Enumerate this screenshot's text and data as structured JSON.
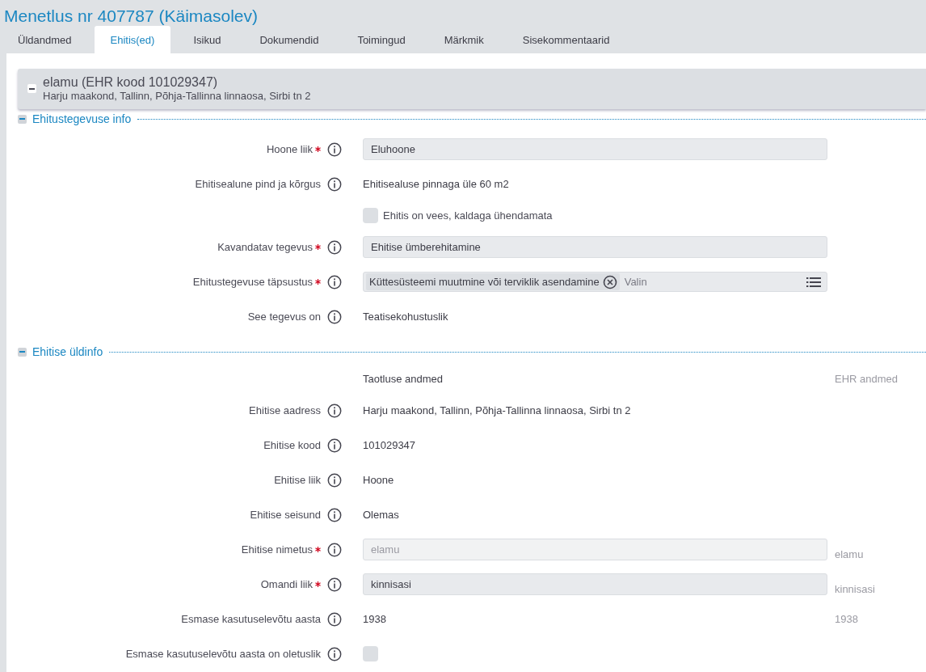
{
  "title": "Menetlus nr 407787 (Käimasolev)",
  "tabs": [
    {
      "label": "Üldandmed",
      "selected": false
    },
    {
      "label": "Ehitis(ed)",
      "selected": true
    },
    {
      "label": "Isikud",
      "selected": false
    },
    {
      "label": "Dokumendid",
      "selected": false
    },
    {
      "label": "Toimingud",
      "selected": false
    },
    {
      "label": "Märkmik",
      "selected": false
    },
    {
      "label": "Sisekommentaarid",
      "selected": false
    }
  ],
  "structure": {
    "title": "elamu (EHR kood 101029347)",
    "address": "Harju maakond, Tallinn, Põhja-Tallinna linnaosa, Sirbi tn 2",
    "expanded": true
  },
  "sections": [
    {
      "title": "Ehitustegevuse info",
      "expanded": true,
      "rows": [
        {
          "kind": "select",
          "label": "Hoone liik",
          "required": true,
          "value": "Eluhoone"
        },
        {
          "kind": "text",
          "label": "Ehitisealune pind ja kõrgus",
          "required": false,
          "value": "Ehitisealuse pinnaga üle 60 m2"
        },
        {
          "kind": "option",
          "text": "Ehitis on vees, kaldaga ühendamata",
          "checked": false
        },
        {
          "kind": "select",
          "label": "Kavandatav tegevus",
          "required": true,
          "value": "Ehitise ümberehitamine"
        },
        {
          "kind": "multiselect",
          "label": "Ehitustegevuse täpsustus",
          "required": true,
          "chips": [
            "Küttesüsteemi muutmine või terviklik asendamine"
          ],
          "placeholder": "Valin"
        },
        {
          "kind": "text",
          "label": "See tegevus on",
          "required": false,
          "value": "Teatisekohustuslik"
        }
      ]
    },
    {
      "title": "Ehitise üldinfo",
      "expanded": true,
      "headings": {
        "application": "Taotluse andmed",
        "ehr": "EHR andmed"
      },
      "rows": [
        {
          "kind": "text",
          "label": "Ehitise aadress",
          "required": false,
          "value": "Harju maakond, Tallinn, Põhja-Tallinna linnaosa, Sirbi tn 2"
        },
        {
          "kind": "text",
          "label": "Ehitise kood",
          "required": false,
          "value": "101029347"
        },
        {
          "kind": "text",
          "label": "Ehitise liik",
          "required": false,
          "value": "Hoone"
        },
        {
          "kind": "text",
          "label": "Ehitise seisund",
          "required": false,
          "value": "Olemas"
        },
        {
          "kind": "input",
          "label": "Ehitise nimetus",
          "required": true,
          "value": "elamu",
          "disabled": true,
          "ehr": "elamu"
        },
        {
          "kind": "input",
          "label": "Omandi liik",
          "required": true,
          "value": "kinnisasi",
          "disabled": false,
          "ehr": "kinnisasi"
        },
        {
          "kind": "text",
          "label": "Esmase kasutuselevõtu aasta",
          "required": false,
          "value": "1938",
          "ehr": "1938"
        },
        {
          "kind": "checkbox",
          "label": "Esmase kasutuselevõtu aasta on oletuslik",
          "required": false,
          "checked": false
        }
      ]
    }
  ]
}
